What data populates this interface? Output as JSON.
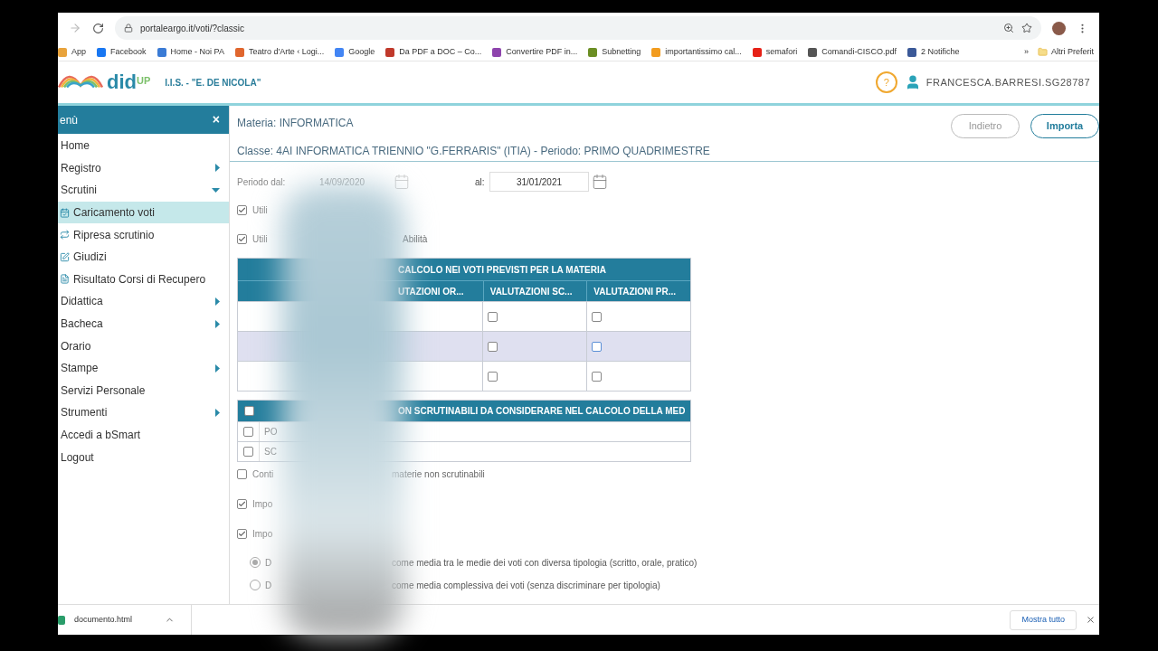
{
  "browser": {
    "url": "portaleargo.it/voti/?classic",
    "bookmarks": [
      {
        "label": "App",
        "color": "#e8a33c"
      },
      {
        "label": "Facebook",
        "color": "#1877f2"
      },
      {
        "label": "Home - Noi PA",
        "color": "#3a7bd5"
      },
      {
        "label": "Teatro d'Arte ‹ Logi...",
        "color": "#e0662e"
      },
      {
        "label": "Google",
        "color": "#4285f4"
      },
      {
        "label": "Da PDF a DOC – Co...",
        "color": "#c0392b"
      },
      {
        "label": "Convertire PDF in...",
        "color": "#8e44ad"
      },
      {
        "label": "Subnetting",
        "color": "#6b8e23"
      },
      {
        "label": "importantissimo cal...",
        "color": "#f29c1f"
      },
      {
        "label": "semafori",
        "color": "#e62117"
      },
      {
        "label": "Comandi-CISCO.pdf",
        "color": "#555555"
      },
      {
        "label": "2 Notifiche",
        "color": "#3b5998"
      }
    ],
    "overflow": "»",
    "other": "Altri Preferit"
  },
  "header": {
    "logo": "did",
    "logo_sup": "UP",
    "school": "I.I.S. - \"E. DE NICOLA\"",
    "help": "?",
    "user": "FRANCESCA.BARRESI.SG28787"
  },
  "sidebar": {
    "title": "enù",
    "close": "×",
    "items": [
      {
        "label": "Home",
        "kind": "plain"
      },
      {
        "label": "Registro",
        "kind": "submenu",
        "expanded": false
      },
      {
        "label": "Scrutini",
        "kind": "submenu",
        "expanded": true,
        "children": [
          {
            "label": "Caricamento voti",
            "selected": true
          },
          {
            "label": "Ripresa scrutinio",
            "selected": false
          },
          {
            "label": "Giudizi",
            "selected": false
          },
          {
            "label": "Risultato Corsi di Recupero",
            "selected": false
          }
        ]
      },
      {
        "label": "Didattica",
        "kind": "submenu",
        "expanded": false
      },
      {
        "label": "Bacheca",
        "kind": "submenu",
        "expanded": false
      },
      {
        "label": "Orario",
        "kind": "plain"
      },
      {
        "label": "Stampe",
        "kind": "submenu",
        "expanded": false
      },
      {
        "label": "Servizi Personale",
        "kind": "plain"
      },
      {
        "label": "Strumenti",
        "kind": "submenu",
        "expanded": false
      },
      {
        "label": "Accedi a bSmart",
        "kind": "plain"
      },
      {
        "label": "Logout",
        "kind": "plain"
      }
    ]
  },
  "content": {
    "materia": "Materia: INFORMATICA",
    "classe": "Classe: 4AI INFORMATICA TRIENNIO \"G.FERRARIS\" (ITIA) - Periodo: PRIMO QUADRIMESTRE",
    "buttons": [
      {
        "label": "Indietro",
        "disabled": true
      },
      {
        "label": "Importa",
        "disabled": false
      }
    ],
    "period": {
      "from_label": "Periodo dal:",
      "from": "14/09/2020",
      "from_disabled": true,
      "to_label": "al:",
      "to": "31/01/2021"
    },
    "options": [
      {
        "label": "Utili",
        "checked": true
      },
      {
        "label": "Utili",
        "tail": "Abilità",
        "checked": true
      }
    ],
    "table1": {
      "title": "CALCOLO NEI VOTI PREVISTI PER LA MATERIA",
      "columns": [
        "UTAZIONI OR...",
        "VALUTAZIONI SC...",
        "VALUTAZIONI PR..."
      ],
      "rows": [
        {
          "hovered": false,
          "checks": [
            false,
            false
          ]
        },
        {
          "hovered": true,
          "checks": [
            false,
            false
          ]
        },
        {
          "hovered": false,
          "checks": [
            false,
            false
          ]
        }
      ]
    },
    "table2": {
      "checked": false,
      "title": "ON SCRUTINABILI DA CONSIDERARE NEL CALCOLO DELLA MED",
      "rows": [
        {
          "label": "PO",
          "checked": false
        },
        {
          "label": "SC",
          "checked": false
        }
      ]
    },
    "settings": [
      {
        "label": "Conti",
        "tail": "materie non scrutinabili",
        "checked": false
      },
      {
        "label": "Impo",
        "checked": true
      },
      {
        "label": "Impo",
        "checked": true
      }
    ],
    "radios": [
      {
        "label": "D",
        "tail": "come media tra le medie dei voti con diversa tipologia (scritto, orale, pratico)",
        "selected": true
      },
      {
        "label": "D",
        "tail": "come media complessiva dei voti (senza discriminare per tipologia)",
        "selected": false
      }
    ]
  },
  "downloads": {
    "file": "documento.html",
    "show_all": "Mostra tutto"
  }
}
